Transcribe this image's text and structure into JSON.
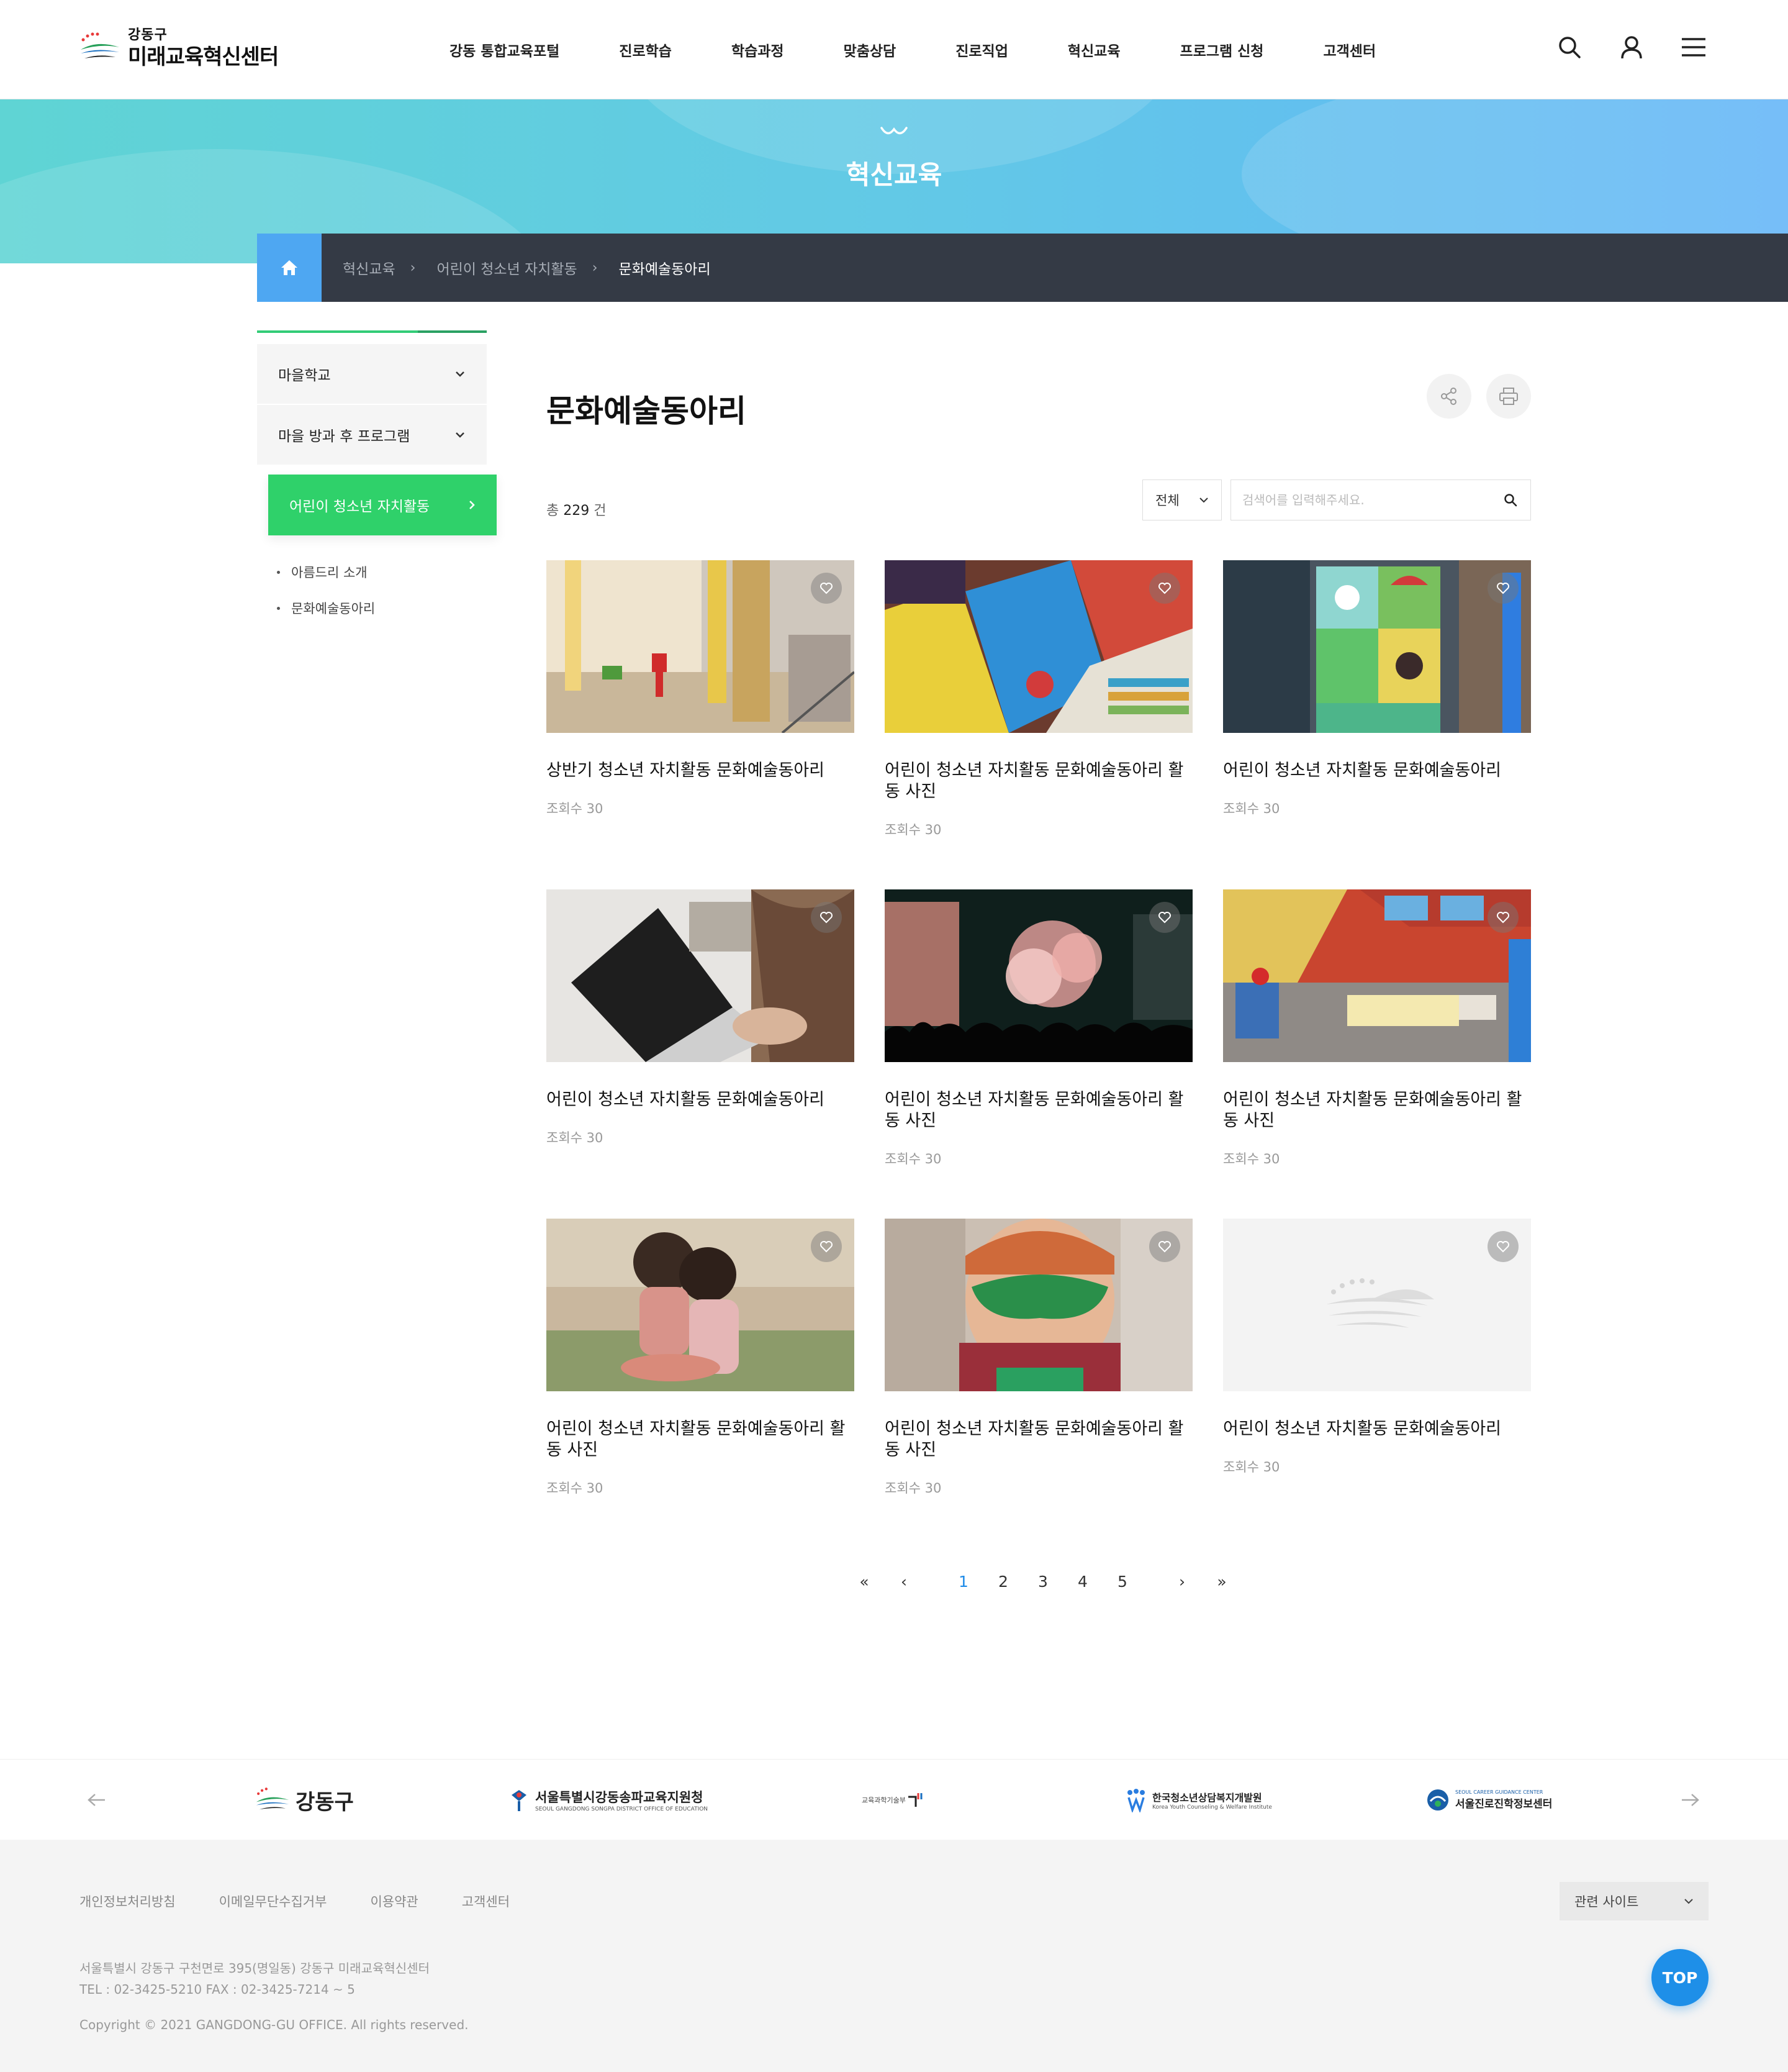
{
  "header": {
    "logo_small": "강동구",
    "logo_big": "미래교육혁신센터",
    "nav": [
      "강동 통합교육포털",
      "진로학습",
      "학습과정",
      "맞춤상담",
      "진로직업",
      "혁신교육",
      "프로그램 신청",
      "고객센터"
    ]
  },
  "banner": {
    "title": "혁신교육"
  },
  "breadcrumb": {
    "items": [
      "혁신교육",
      "어린이 청소년 자치활동",
      "문화예술동아리"
    ]
  },
  "side_menu": {
    "groups": [
      "마을학교",
      "마을 방과 후 프로그램"
    ],
    "active": "어린이 청소년 자치활동",
    "sub_items": [
      "아름드리 소개",
      "문화예술동아리"
    ]
  },
  "content": {
    "title": "문화예술동아리",
    "total_prefix": "총",
    "total_count": "229",
    "total_suffix": "건",
    "select_value": "전체",
    "search_placeholder": "검색어를 입력해주세요."
  },
  "gallery": [
    {
      "title": "상반기 청소년 자치활동 문화예술동아리",
      "views": "조회수 30",
      "image": "toy-playground"
    },
    {
      "title": "어린이 청소년 자치활동 문화예술동아리 활동 사진",
      "views": "조회수 30",
      "image": "colorful-books"
    },
    {
      "title": "어린이 청소년 자치활동 문화예술동아리",
      "views": "조회수 30",
      "image": "toy-blocks"
    },
    {
      "title": "어린이 청소년 자치활동 문화예술동아리",
      "views": "조회수 30",
      "image": "laptop"
    },
    {
      "title": "어린이 청소년 자치활동 문화예술동아리 활동 사진",
      "views": "조회수 30",
      "image": "fireworks-crowd"
    },
    {
      "title": "어린이 청소년 자치활동 문화예술동아리 활동 사진",
      "views": "조회수 30",
      "image": "toy-bedroom"
    },
    {
      "title": "어린이 청소년 자치활동 문화예술동아리 활동 사진",
      "views": "조회수 30",
      "image": "children-sitting"
    },
    {
      "title": "어린이 청소년 자치활동 문화예술동아리 활동 사진",
      "views": "조회수 30",
      "image": "child-green-mask"
    },
    {
      "title": "어린이 청소년 자치활동 문화예술동아리",
      "views": "조회수 30",
      "image": "placeholder-logo"
    }
  ],
  "pagination": {
    "first": "«",
    "prev": "‹",
    "pages": [
      "1",
      "2",
      "3",
      "4",
      "5"
    ],
    "current": "1",
    "next": "›",
    "last": "»"
  },
  "partners": [
    {
      "name": "강동구"
    },
    {
      "name": "서울특별시강동송파교육지원청",
      "sub": "SEOUL GANGDONG SONGPA DISTRICT OFFICE OF EDUCATION"
    },
    {
      "name": "교육과학기술부"
    },
    {
      "name": "한국청소년상담복지개발원",
      "sub": "Korea Youth Counseling & Welfare Institute"
    },
    {
      "name": "서울진로진학정보센터",
      "sub": "SEOUL CAREER GUIDANCE CENTER"
    }
  ],
  "footer": {
    "links": [
      "개인정보처리방침",
      "이메일무단수집거부",
      "이용약관",
      "고객센터"
    ],
    "family_site": "관련 사이트",
    "address": "서울특별시 강동구 구천면로 395(명일동) 강동구 미래교육혁신센터",
    "contact": "TEL : 02-3425-5210 FAX : 02-3425-7214 ~ 5",
    "copyright": "Copyright © 2021 GANGDONG-GU OFFICE. All rights reserved.",
    "top_label": "TOP"
  },
  "colors": {
    "accent_green": "#2fd16a",
    "accent_blue": "#1e8fe8",
    "breadcrumb_bg": "#343a45"
  }
}
